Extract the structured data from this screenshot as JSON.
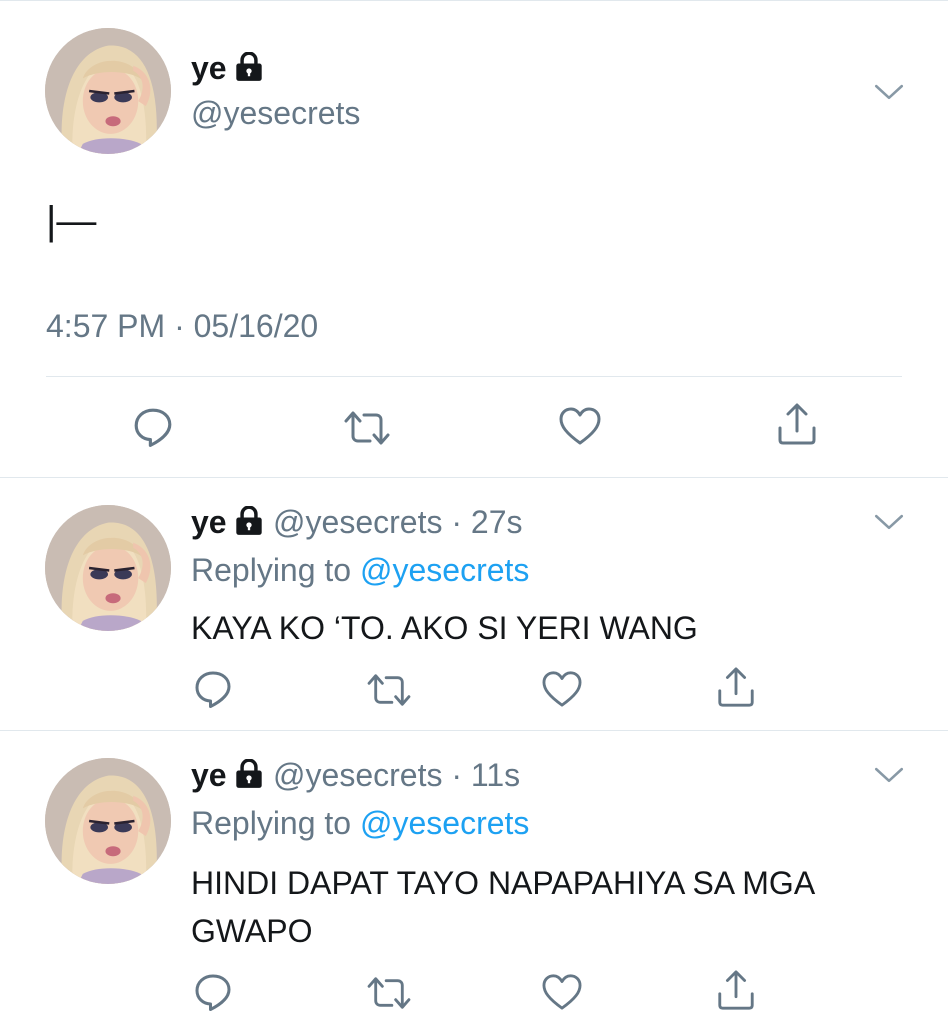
{
  "main_tweet": {
    "display_name": "ye",
    "handle": "@yesecrets",
    "text": "|—",
    "timestamp": "4:57 PM · 05/16/20"
  },
  "replies": [
    {
      "display_name": "ye",
      "handle_time": "@yesecrets · 27s",
      "replying_prefix": "Replying to ",
      "replying_to": "@yesecrets",
      "text": "KAYA KO ‘TO. AKO SI YERI WANG"
    },
    {
      "display_name": "ye",
      "handle_time": "@yesecrets · 11s",
      "replying_prefix": "Replying to ",
      "replying_to": "@yesecrets",
      "text_line1": "HINDI DAPAT TAYO NAPAPAHIYA SA MGA",
      "text_line2": "GWAPO"
    }
  ],
  "icons": {
    "protected": "lock-icon",
    "menu": "chevron-down-icon",
    "reply": "reply-icon",
    "retweet": "retweet-icon",
    "like": "heart-icon",
    "share": "share-icon"
  },
  "colors": {
    "text": "#14171a",
    "secondary": "#657786",
    "link": "#1da1f2",
    "divider": "#e1e8ed",
    "icon": "#657786"
  }
}
